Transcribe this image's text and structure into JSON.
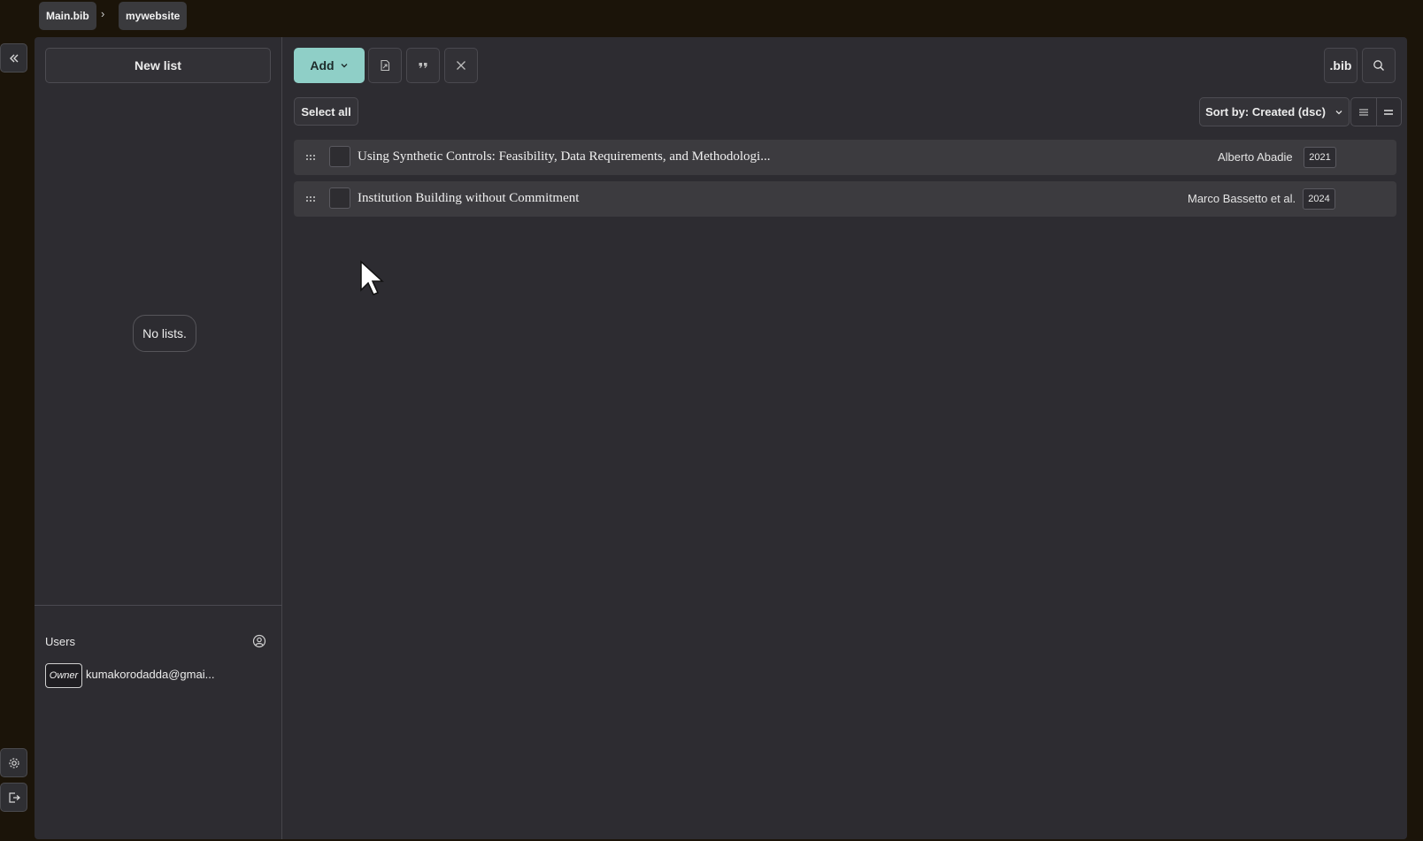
{
  "breadcrumb": {
    "items": [
      "Main.bib",
      "mywebsite"
    ],
    "separator": "›"
  },
  "sidebar": {
    "new_list_label": "New list",
    "empty_message": "No lists.",
    "users_title": "Users",
    "users": [
      {
        "role": "Owner",
        "email": "kumakorodadda@gmai..."
      }
    ]
  },
  "toolbar": {
    "add_label": "Add",
    "bib_label": ".bib",
    "select_all_label": "Select all",
    "sort_label": "Sort by: Created (dsc)"
  },
  "entries": [
    {
      "title": "Using Synthetic Controls: Feasibility, Data Requirements, and Methodologi...",
      "author": "Alberto Abadie",
      "year": "2021"
    },
    {
      "title": "Institution Building without Commitment",
      "author": "Marco Bassetto et al.",
      "year": "2024"
    }
  ],
  "colors": {
    "accent": "#8fcfc7",
    "background": "#2d2c31",
    "frame": "#1b1409"
  },
  "icons": [
    "collapse-sidebar-icon",
    "settings-icon",
    "logout-icon",
    "add-user-icon",
    "export-icon",
    "quote-icon",
    "close-icon",
    "search-icon",
    "drag-handle-icon",
    "list-view-icon",
    "compact-view-icon",
    "chevron-down-icon"
  ]
}
